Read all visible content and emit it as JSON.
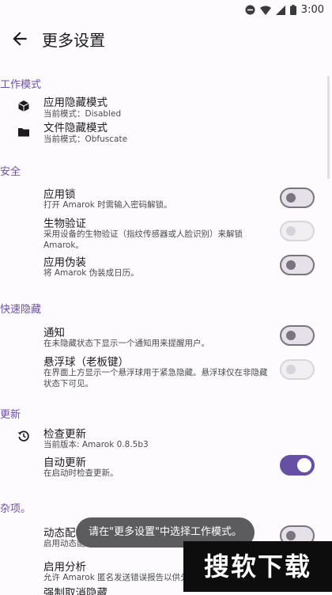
{
  "status_bar": {
    "time": "3:00"
  },
  "app_bar": {
    "title": "更多设置",
    "back_icon": "arrow-left-icon"
  },
  "sections": {
    "work_mode": {
      "header": "工作模式",
      "app_hide": {
        "title": "应用隐藏模式",
        "subtitle": "当前模式：Disabled",
        "icon": "cube-icon"
      },
      "file_hide": {
        "title": "文件隐藏模式",
        "subtitle": "当前模式：Obfuscate",
        "icon": "folder-icon"
      }
    },
    "security": {
      "header": "安全",
      "app_lock": {
        "title": "应用锁",
        "subtitle": "打开 Amarok 时需输入密码解锁。",
        "enabled": false
      },
      "biometric": {
        "title": "生物验证",
        "subtitle": "采用设备的生物验证（指纹传感器或人脸识别）来解锁 Amarok。",
        "enabled": false
      },
      "disguise": {
        "title": "应用伪装",
        "subtitle": "将 Amarok 伪装成日历。",
        "enabled": false
      }
    },
    "quick_hide": {
      "header": "快速隐藏",
      "notification": {
        "title": "通知",
        "subtitle": "在未隐藏状态下显示一个通知用来提醒用户。",
        "enabled": false
      },
      "float_ball": {
        "title": "悬浮球（老板键）",
        "subtitle": "在界面上方显示一个悬浮球用于紧急隐藏。悬浮球仅在非隐藏状态下可见。",
        "enabled": false
      }
    },
    "update": {
      "header": "更新",
      "check": {
        "title": "检查更新",
        "subtitle": "当前版本: Amarok 0.8.5b3",
        "icon": "history-icon"
      },
      "auto": {
        "title": "自动更新",
        "subtitle": "在启动时检查更新。",
        "enabled": true
      }
    },
    "misc": {
      "header": "杂项。",
      "dynamic": {
        "title": "动态配色",
        "subtitle": "启用动态配色"
      },
      "analytics": {
        "title": "启用分析",
        "subtitle": "允许 Amarok 匿名发送错误报告以供分析"
      },
      "partial": {
        "title": "强制取消隐藏"
      }
    }
  },
  "toast": "请在\"更多设置\"中选择工作模式。",
  "watermark": "搜软下载",
  "colors": {
    "accent": "#6750a4",
    "section_header": "#6d4fa8"
  }
}
